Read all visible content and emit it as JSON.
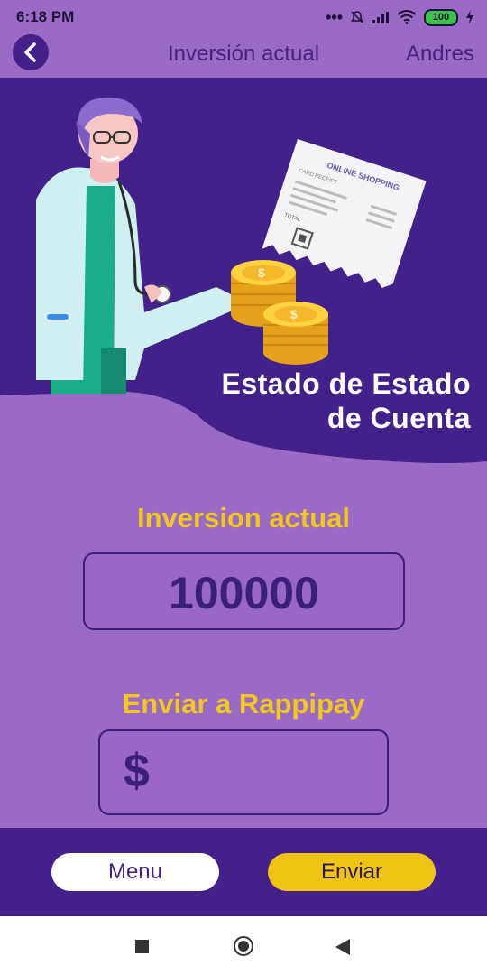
{
  "status_bar": {
    "time": "6:18 PM",
    "battery": "100"
  },
  "app_bar": {
    "title": "Inversión actual",
    "user": "Andres"
  },
  "banner": {
    "title_line1": "Estado de Estado",
    "title_line2": "de Cuenta"
  },
  "receipt": {
    "heading": "ONLINE SHOPPING",
    "subheading": "CARD RECEIPT",
    "total_label": "TOTAL"
  },
  "investment": {
    "label": "Inversion actual",
    "value": "100000"
  },
  "send": {
    "label": "Enviar a Rappipay",
    "currency_symbol": "$",
    "input_value": "",
    "input_placeholder": ""
  },
  "actions": {
    "menu_label": "Menu",
    "send_label": "Enviar"
  },
  "colors": {
    "background": "#9a6ac7",
    "dark_purple": "#44218a",
    "accent_yellow": "#f1c81b",
    "white": "#ffffff"
  }
}
